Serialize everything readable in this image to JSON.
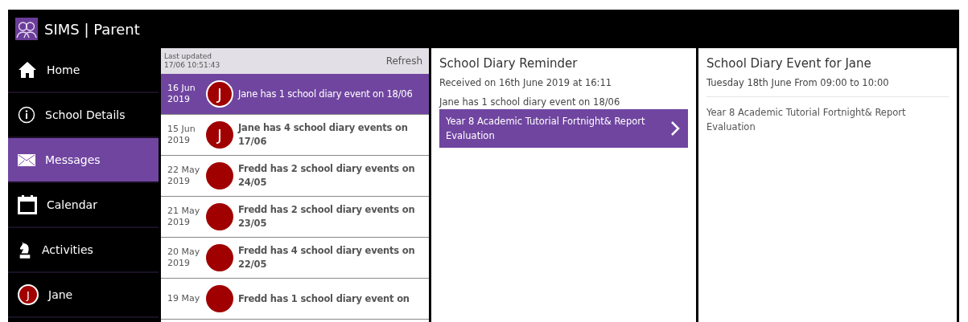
{
  "app": {
    "title": "SIMS | Parent"
  },
  "nav": [
    {
      "label": "Home",
      "selected": false
    },
    {
      "label": "School Details",
      "selected": false
    },
    {
      "label": "Messages",
      "selected": true
    },
    {
      "label": "Calendar",
      "selected": false
    },
    {
      "label": "Activities",
      "selected": false
    },
    {
      "label": "Jane",
      "initial": "J",
      "selected": false
    }
  ],
  "messages": {
    "last_updated_label": "Last updated",
    "last_updated": "17/06 10:51:43",
    "refresh": "Refresh",
    "items": [
      {
        "day": "16 Jun",
        "year": "2019",
        "initial": "J",
        "text": "Jane has 1 school diary event on 18/06",
        "unread": false,
        "selected": true
      },
      {
        "day": "15 Jun",
        "year": "2019",
        "initial": "J",
        "text": "Jane has 4 school diary events on 17/06",
        "unread": true,
        "selected": false
      },
      {
        "day": "22 May",
        "year": "2019",
        "text": "Fredd has 2 school diary events on 24/05",
        "unread": true,
        "selected": false
      },
      {
        "day": "21 May",
        "year": "2019",
        "text": "Fredd has 2 school diary events on 23/05",
        "unread": true,
        "selected": false
      },
      {
        "day": "20 May",
        "year": "2019",
        "text": "Fredd has 4 school diary events on 22/05",
        "unread": true,
        "selected": false
      },
      {
        "day": "19 May",
        "text": "Fredd has 1 school diary event on",
        "unread": true,
        "selected": false
      }
    ]
  },
  "reminder": {
    "title": "School Diary Reminder",
    "received": "Received on 16th June 2019 at 16:11",
    "summary": "Jane has 1 school diary event on 18/06",
    "event_link": "Year 8 Academic Tutorial Fortnight& Report Evaluation"
  },
  "event": {
    "title": "School Diary Event for Jane",
    "when": "Tuesday 18th June From 09:00 to 10:00",
    "description": "Year 8 Academic Tutorial Fortnight& Report Evaluation"
  }
}
